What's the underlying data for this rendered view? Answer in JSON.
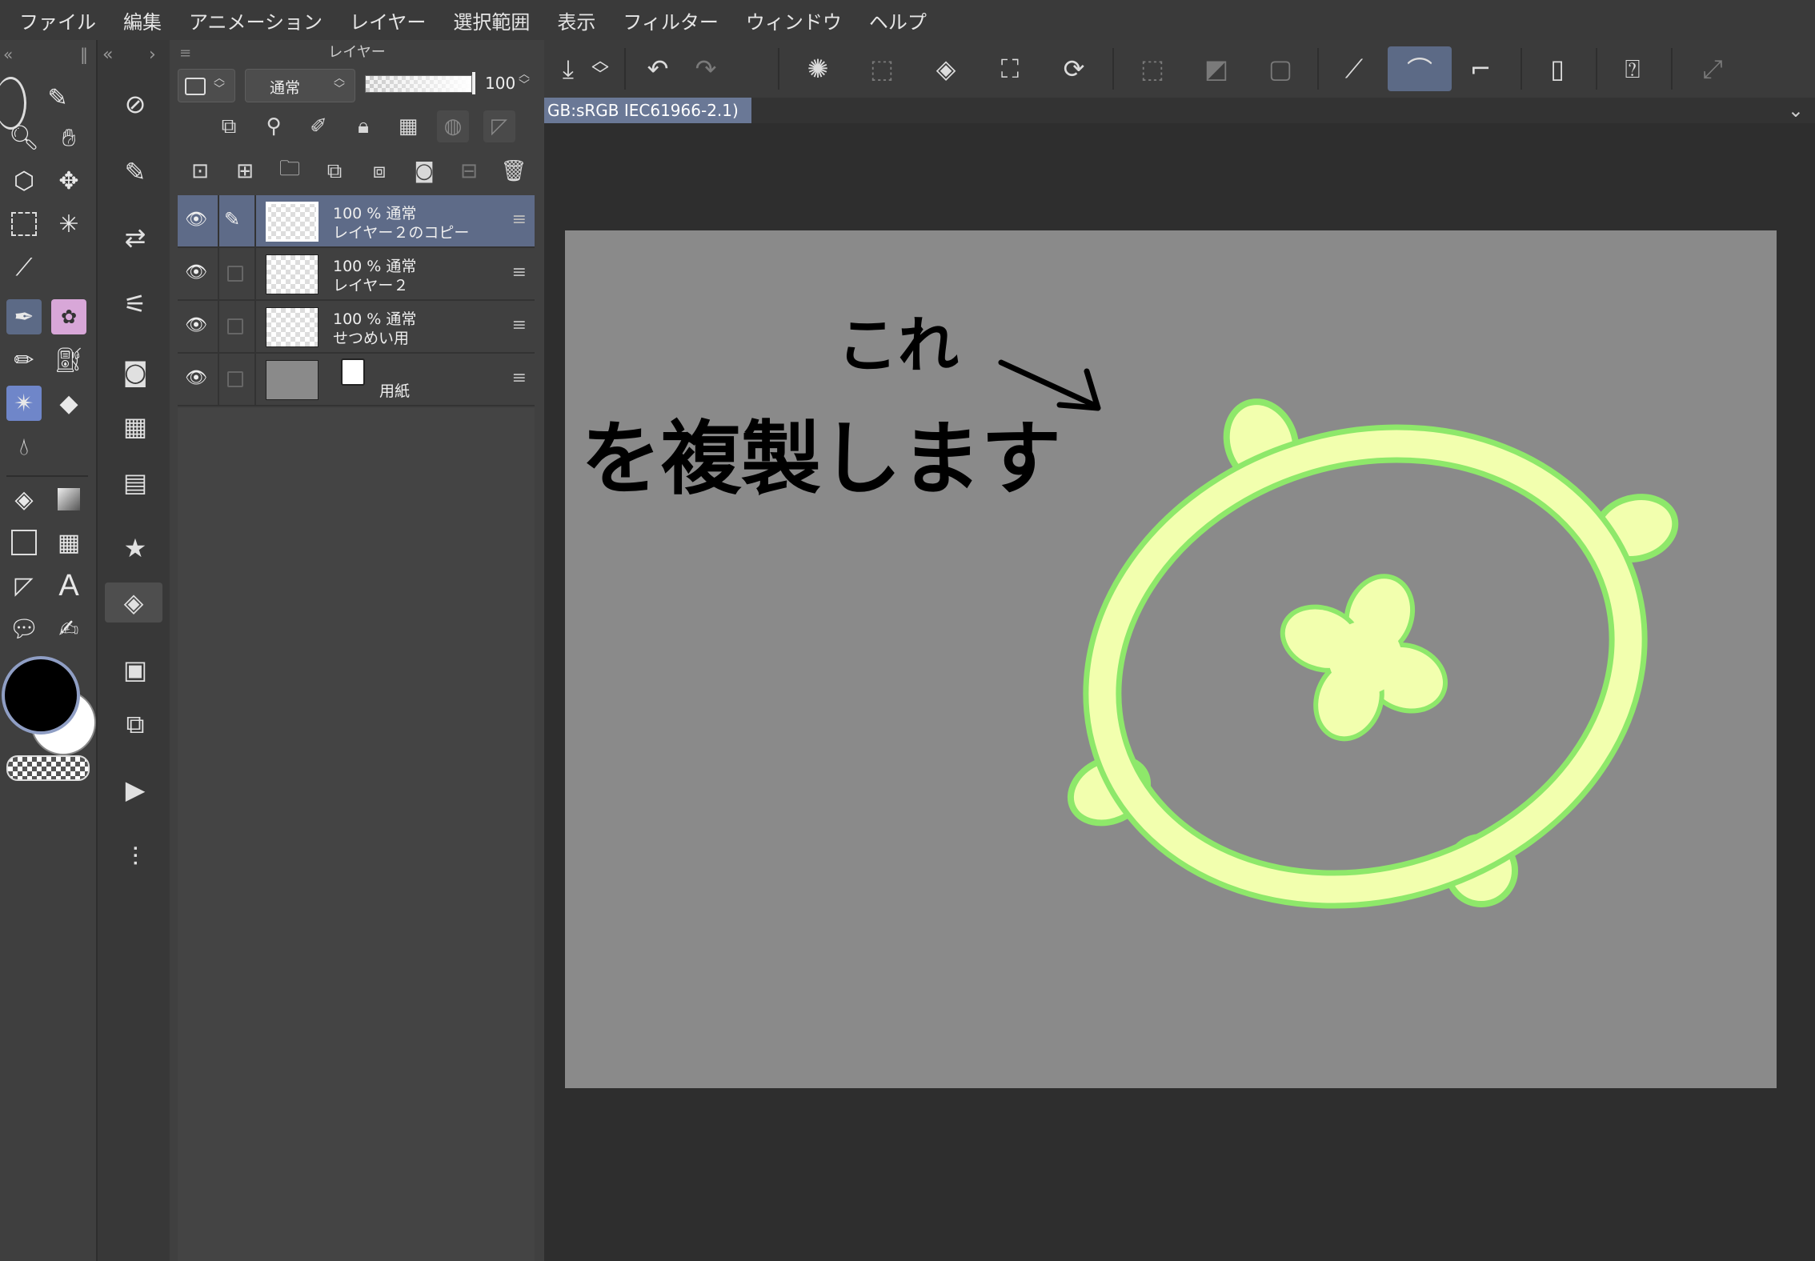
{
  "menubar": {
    "items": [
      "ファイル",
      "編集",
      "アニメーション",
      "レイヤー",
      "選択範囲",
      "表示",
      "フィルター",
      "ウィンドウ",
      "ヘルプ"
    ]
  },
  "layer_panel": {
    "title": "レイヤー",
    "blend_mode": "通常",
    "opacity": "100",
    "layers": [
      {
        "line1": "100 % 通常",
        "line2": "レイヤー２のコピー",
        "selected": true
      },
      {
        "line1": "100 % 通常",
        "line2": "レイヤー２",
        "selected": false
      },
      {
        "line1": "100 % 通常",
        "line2": "せつめい用",
        "selected": false
      },
      {
        "line1": "",
        "line2": "用紙",
        "selected": false
      }
    ]
  },
  "document_tab": {
    "label": "GB:sRGB IEC61966-2.1)"
  },
  "canvas": {
    "background": "#8a8a8a",
    "annotation_top": "これ",
    "annotation_main": "を複製します",
    "shape_fill": "#f2ffae",
    "shape_stroke": "#8ee86a"
  },
  "colors": {
    "accent": "#5c6a86",
    "main_color": "#000000",
    "sub_color": "#ffffff"
  }
}
